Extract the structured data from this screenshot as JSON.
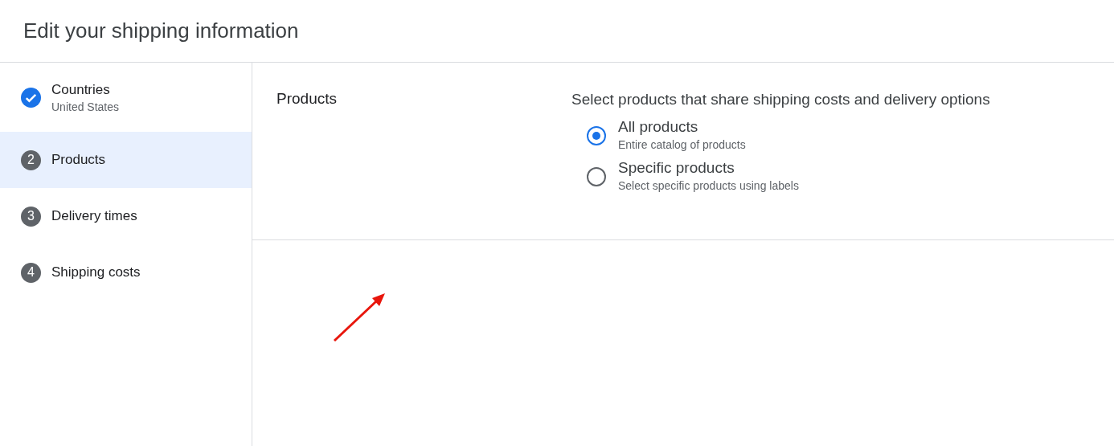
{
  "title": "Edit your shipping information",
  "steps": [
    {
      "label": "Countries",
      "sublabel": "United States",
      "completed": true,
      "selected": false
    },
    {
      "number": "2",
      "label": "Products",
      "completed": false,
      "selected": true
    },
    {
      "number": "3",
      "label": "Delivery times",
      "completed": false,
      "selected": false
    },
    {
      "number": "4",
      "label": "Shipping costs",
      "completed": false,
      "selected": false
    }
  ],
  "section": {
    "heading": "Products",
    "prompt": "Select products that share shipping costs and delivery options",
    "options": [
      {
        "label": "All products",
        "description": "Entire catalog of products",
        "selected": true
      },
      {
        "label": "Specific products",
        "description": "Select specific products using labels",
        "selected": false
      }
    ]
  }
}
